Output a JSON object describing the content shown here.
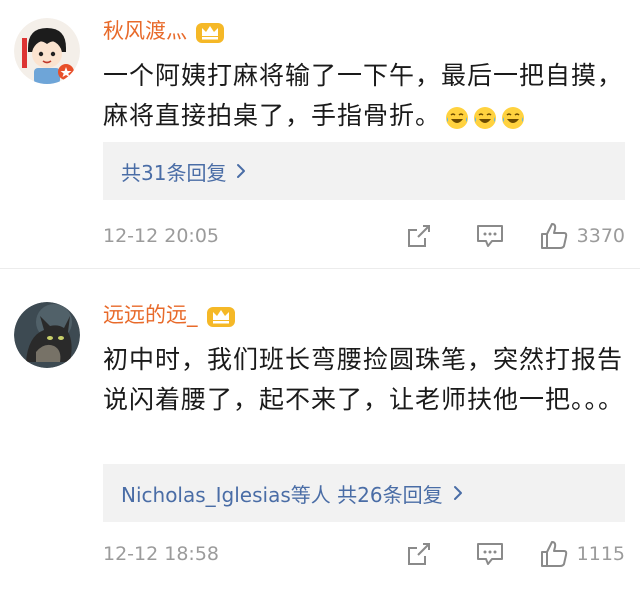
{
  "comments": [
    {
      "username": "秋风渡灬",
      "text": "一个阿姨打麻将输了一下午，最后一把自摸，麻将直接拍桌了，手指骨折。",
      "emoji_icons": [
        "laughing-tears-icon",
        "laughing-tears-icon",
        "laughing-tears-icon"
      ],
      "replies_label": "共31条回复",
      "timestamp": "12-12 20:05",
      "like_count": "3370"
    },
    {
      "username": "远远的远_",
      "text": "初中时，我们班长弯腰捡圆珠笔，突然打报告说闪着腰了，起不来了，让老师扶他一把。。。",
      "replies_label": "Nicholas_Iglesias等人 共26条回复",
      "timestamp": "12-12 18:58",
      "like_count": "1115"
    }
  ],
  "colors": {
    "username": "#e86a2a",
    "link": "#4a6da6",
    "meta": "#9b9b9b",
    "reply_bg": "#f2f2f2",
    "badge_gold": "#f5b827"
  },
  "icons": [
    "crown-vip-icon",
    "chevron-right-icon",
    "share-icon",
    "comment-icon",
    "thumbs-up-icon"
  ]
}
